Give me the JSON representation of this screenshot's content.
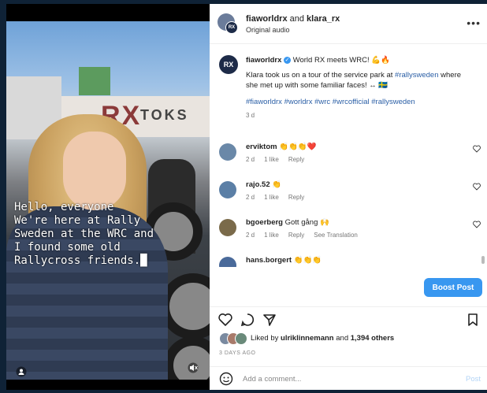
{
  "video": {
    "caption": "Hello, everyone\nWe're here at Rally\nSweden at the WRC and\nI found some old\nRallycross friends.",
    "cursor": "█",
    "brand_text": "RX",
    "brand_word": "TOKS"
  },
  "header": {
    "user1": "fiaworldrx",
    "and_text": " and ",
    "user2": "klara_rx",
    "subtitle": "Original audio",
    "more": "•••"
  },
  "post": {
    "avatar_text": "RX",
    "user": "fiaworldrx",
    "verified": "✓",
    "line1": "World RX meets WRC! 💪🔥",
    "line2a": "Klara took us on a tour of the service park at ",
    "line2tag": "#rallysweden",
    "line2b": " where she met up with some familiar faces! ↔ 🇸🇪",
    "hashtags": "#fiaworldrx #worldrx #wrc #wrcofficial #rallysweden",
    "time": "3 d"
  },
  "comments": [
    {
      "user": "erviktom",
      "text": "👏👏👏❤️",
      "meta": [
        "2 d",
        "1 like",
        "Reply"
      ],
      "avatar_color": "#6a88a8"
    },
    {
      "user": "rajo.52",
      "text": "👏",
      "meta": [
        "2 d",
        "1 like",
        "Reply"
      ],
      "avatar_color": "#5b7fa6"
    },
    {
      "user": "bgoerberg",
      "text": "Gott gång 🙌",
      "meta": [
        "2 d",
        "1 like",
        "Reply",
        "See Translation"
      ],
      "avatar_color": "#7a6a4a"
    },
    {
      "user": "hans.borgert",
      "text": "👏👏👏",
      "meta": [],
      "avatar_color": "#4a6a9a"
    }
  ],
  "boost_label": "Boost Post",
  "likes": {
    "prefix": "Liked by ",
    "user": "ulriklinnemann",
    "mid": " and ",
    "count": "1,394 others"
  },
  "date": "3 DAYS AGO",
  "add_comment": {
    "placeholder": "Add a comment...",
    "post": "Post"
  },
  "colors": {
    "accent": "#3897f0",
    "hashtag": "#2b5fa6"
  }
}
